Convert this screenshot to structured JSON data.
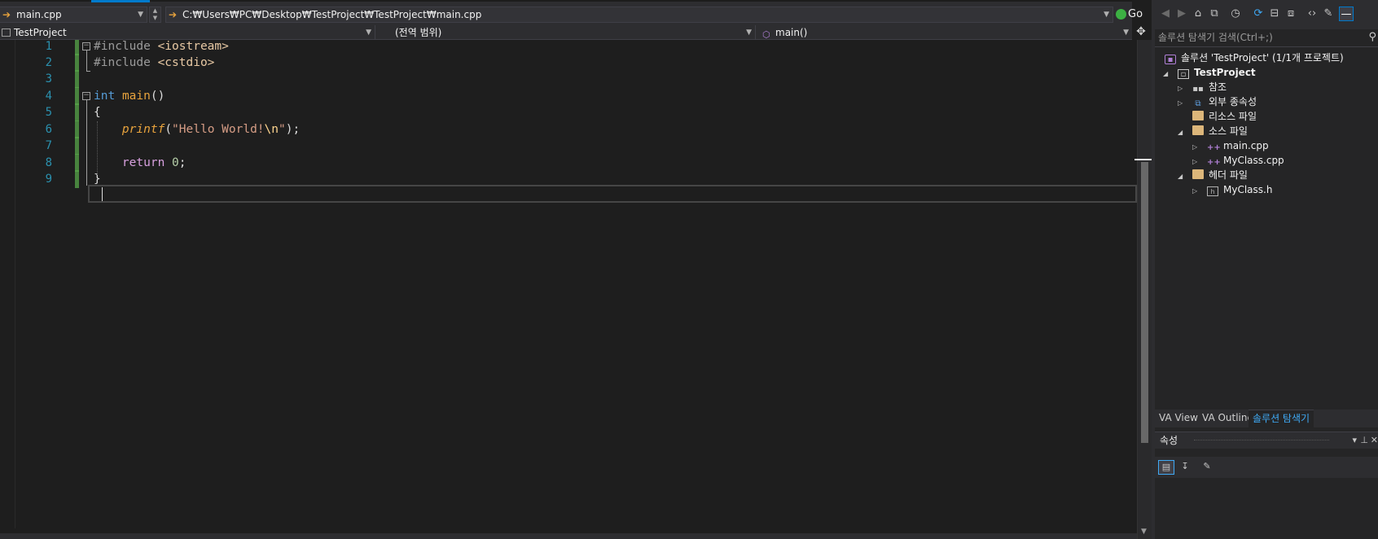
{
  "navbar": {
    "file_combo": "main.cpp",
    "path_combo": "C:₩Users₩PC₩Desktop₩TestProject₩TestProject₩main.cpp",
    "go_label": "Go"
  },
  "nav_dropdowns": {
    "project": "TestProject",
    "scope": "(전역 범위)",
    "member": "main()"
  },
  "editor": {
    "line_numbers": [
      "1",
      "2",
      "3",
      "4",
      "5",
      "6",
      "7",
      "8",
      "9"
    ],
    "lines": {
      "l1_pp": "#include",
      "l1_inc": "<iostream>",
      "l2_pp": "#include",
      "l2_inc": "<cstdio>",
      "l4_kw": "int",
      "l4_fn": "main",
      "l4_paren": "()",
      "l5_brace": "{",
      "l6_fn": "printf",
      "l6_open": "(",
      "l6_str": "\"Hello World!",
      "l6_esc": "\\n",
      "l6_strend": "\"",
      "l6_close": ");",
      "l8_kw": "return",
      "l8_num": "0",
      "l8_semi": ";",
      "l9_brace": "}"
    }
  },
  "solution_explorer": {
    "search_placeholder": "솔루션 탐색기 검색(Ctrl+;)",
    "tree": {
      "solution": "솔루션 'TestProject' (1/1개 프로젝트)",
      "project": "TestProject",
      "references": "참조",
      "external_deps": "외부 종속성",
      "resource_files": "리소스 파일",
      "source_files": "소스 파일",
      "main_cpp": "main.cpp",
      "myclass_cpp": "MyClass.cpp",
      "header_files": "헤더 파일",
      "myclass_h": "MyClass.h"
    },
    "tabs": [
      "VA View",
      "VA Outline",
      "솔루션 탐색기"
    ]
  },
  "properties": {
    "title": "속성"
  },
  "icons": {
    "toolbar": [
      "back-icon",
      "forward-icon",
      "home-icon",
      "switch-views-icon",
      "pending-changes-filter-icon",
      "sync-icon",
      "collapse-all-icon",
      "show-all-files-icon",
      "view-code-icon",
      "properties-wrench-icon",
      "auto-hide-pin-icon"
    ],
    "tree": [
      "solution-icon",
      "project-icon",
      "references-icon",
      "external-dependencies-icon",
      "folder-icon",
      "cpp-file-icon",
      "header-file-icon"
    ]
  },
  "colors": {
    "accent": "#007acc",
    "editor_bg": "#1e1e1e",
    "line_number": "#2b91af",
    "keyword": "#569cd6",
    "function": "#e8a33d",
    "string": "#d69d85",
    "control_keyword": "#d8a0df",
    "change_bar": "#57a64a"
  }
}
